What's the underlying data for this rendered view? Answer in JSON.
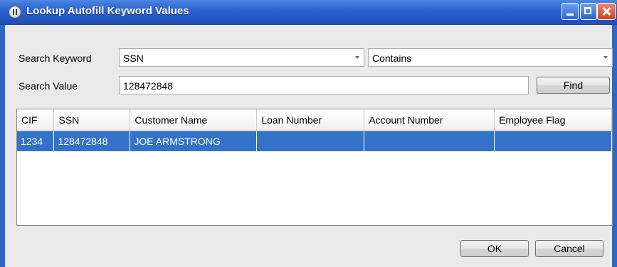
{
  "window": {
    "title": "Lookup Autofill Keyword Values"
  },
  "form": {
    "search_keyword_label": "Search Keyword",
    "search_keyword_value": "SSN",
    "condition_value": "Contains",
    "search_value_label": "Search Value",
    "search_value_input": "128472848",
    "find_label": "Find"
  },
  "table": {
    "columns": [
      "CIF",
      "SSN",
      "Customer Name",
      "Loan Number",
      "Account Number",
      "Employee Flag"
    ],
    "rows": [
      [
        "1234",
        "128472848",
        "JOE ARMSTRONG",
        "",
        "",
        ""
      ]
    ]
  },
  "buttons": {
    "ok_label": "OK",
    "cancel_label": "Cancel"
  },
  "colors": {
    "titlebar": "#2d63d0",
    "selection": "#3273c9",
    "window_bg": "#eaeaea"
  }
}
